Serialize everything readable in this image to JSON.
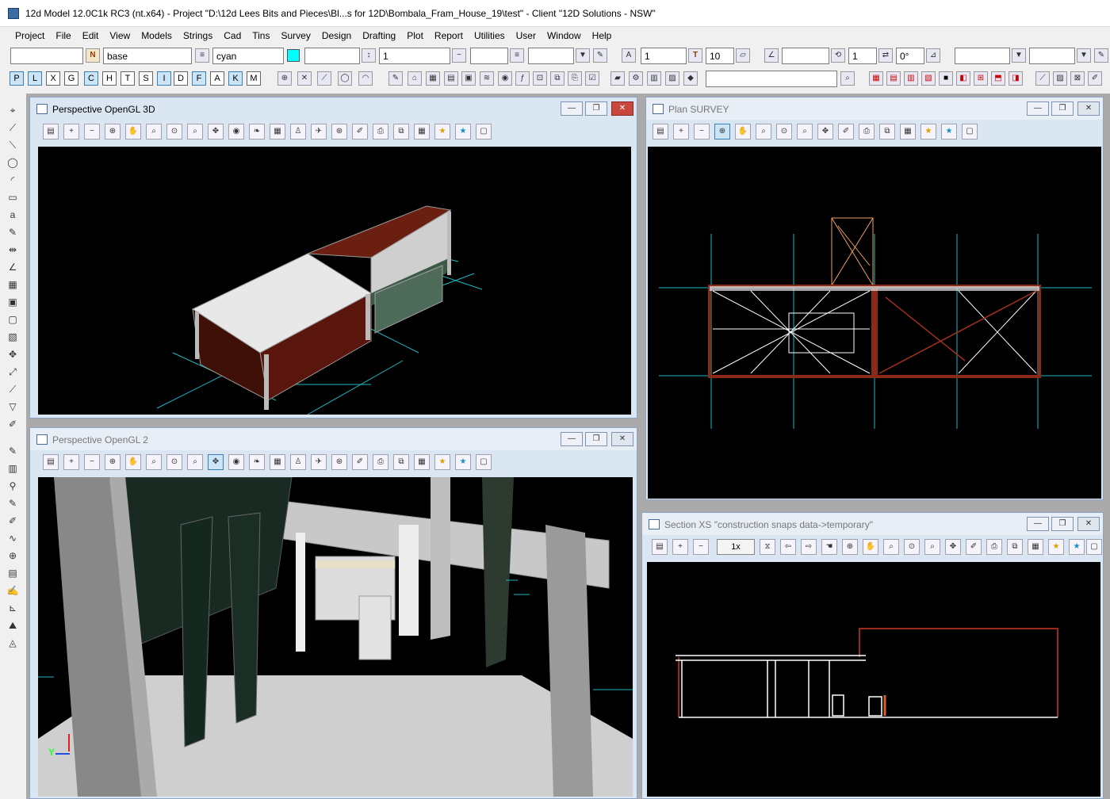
{
  "app": {
    "title": "12d Model  12.0C1k RC3 (nt.x64) - Project \"D:\\12d Lees Bits and Pieces\\Bl...s for 12D\\Bombala_Fram_House_19\\test\" - Client \"12D Solutions - NSW\""
  },
  "menu": [
    "Project",
    "File",
    "Edit",
    "View",
    "Models",
    "Strings",
    "Cad",
    "Tins",
    "Survey",
    "Design",
    "Drafting",
    "Plot",
    "Report",
    "Utilities",
    "User",
    "Window",
    "Help"
  ],
  "toolbar1": {
    "model_value": "",
    "name_value": "base",
    "colour_value": "cyan",
    "colour_hex": "#00ffff",
    "style_value": "",
    "weight_value": "1",
    "linestyle_value": "",
    "text_size_value": "1",
    "text_height_value": "10",
    "angle_value": "1",
    "rotation_value": "0°"
  },
  "toolbar2": {
    "snap_letters": [
      "P",
      "L",
      "X",
      "G",
      "C",
      "H",
      "T",
      "S",
      "I",
      "D",
      "F",
      "A",
      "K",
      "M"
    ],
    "selected_letters": [
      "P",
      "L",
      "C",
      "I",
      "F",
      "K"
    ],
    "search_value": ""
  },
  "windows": {
    "persp3d": {
      "title": "Perspective OpenGL 3D"
    },
    "persp2": {
      "title": "Perspective OpenGL 2"
    },
    "plan": {
      "title": "Plan SURVEY"
    },
    "section": {
      "title": "Section XS \"construction snaps data->temporary\"",
      "zoom_label": "1x"
    }
  },
  "axes_indicator": {
    "y_label": "Y"
  }
}
